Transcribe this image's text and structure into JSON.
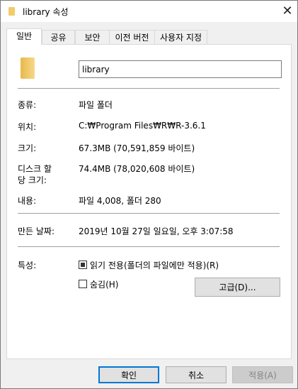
{
  "window": {
    "title": "library 속성",
    "close_icon": "close-icon"
  },
  "tabs": [
    {
      "label": "일반",
      "active": true
    },
    {
      "label": "공유"
    },
    {
      "label": "보안"
    },
    {
      "label": "이전 버전"
    },
    {
      "label": "사용자 지정"
    }
  ],
  "general": {
    "name_value": "library",
    "type_label": "종류:",
    "type_value": "파일 폴더",
    "location_label": "위치:",
    "location_value": "C:₩Program Files₩R₩R-3.6.1",
    "size_label": "크기:",
    "size_value": "67.3MB (70,591,859 바이트)",
    "disk_size_label_1": "디스크 할",
    "disk_size_label_2": "당 크기:",
    "disk_size_value": "74.4MB (78,020,608 바이트)",
    "contents_label": "내용:",
    "contents_value": "파일 4,008, 폴더 280",
    "created_label": "만든 날짜:",
    "created_value": "2019년 10월 27일 일요일, 오후 3:07:58",
    "attributes_label": "특성:",
    "readonly_label": "읽기 전용(폴더의 파일에만 적용)(R)",
    "readonly_state": "indeterminate",
    "hidden_label": "숨김(H)",
    "hidden_checked": false,
    "advanced_label": "고급(D)..."
  },
  "buttons": {
    "ok": "확인",
    "cancel": "취소",
    "apply": "적용(A)"
  }
}
